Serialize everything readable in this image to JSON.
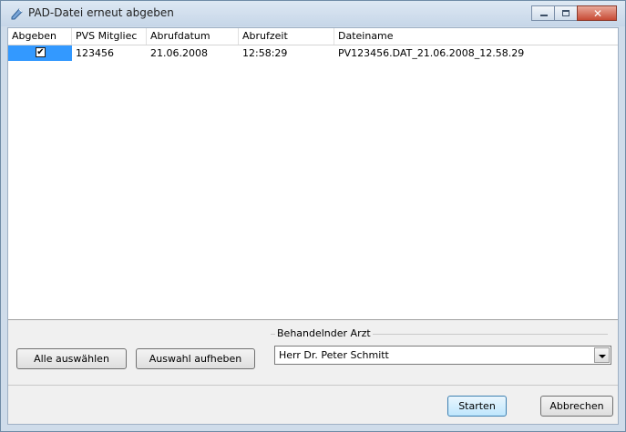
{
  "window": {
    "title": "PAD-Datei erneut abgeben",
    "close_glyph": "✕",
    "accent": "#c74a34"
  },
  "icons": {
    "title": "pencil-document-icon",
    "minimize": "minimize-icon",
    "maximize": "maximize-icon",
    "close": "close-icon",
    "checkbox": "checkbox-checked-icon",
    "dropdown": "chevron-down-icon"
  },
  "table": {
    "columns": [
      "Abgeben",
      "PVS Mitgliec",
      "Abrufdatum",
      "Abrufzeit",
      "Dateiname"
    ],
    "rows": [
      {
        "abgeben": "✔",
        "pvs": "123456",
        "datum": "21.06.2008",
        "zeit": "12:58:29",
        "dateiname": "PV123456.DAT_21.06.2008_12.58.29"
      }
    ]
  },
  "buttons": {
    "select_all": "Alle auswählen",
    "deselect": "Auswahl aufheben",
    "start": "Starten",
    "cancel": "Abbrechen"
  },
  "doctor": {
    "label": "Behandelnder Arzt",
    "value": "Herr Dr. Peter Schmitt"
  }
}
